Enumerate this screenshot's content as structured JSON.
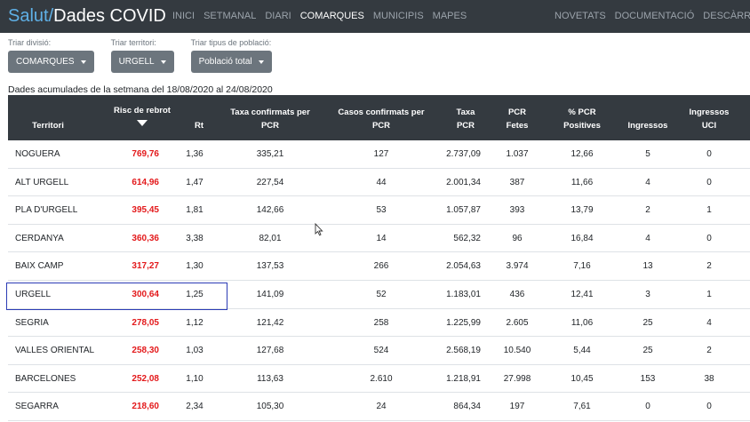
{
  "navbar": {
    "brand_a": "Salut/",
    "brand_b": "Dades COVID",
    "links_left": [
      "INICI",
      "SETMANAL",
      "DIARI",
      "COMARQUES",
      "MUNICIPIS",
      "MAPES"
    ],
    "active_link": "COMARQUES",
    "links_right": [
      "NOVETATS",
      "DOCUMENTACIÓ",
      "DESCÀRREGUES"
    ]
  },
  "filters": [
    {
      "label": "Triar divisió:",
      "value": "COMARQUES"
    },
    {
      "label": "Triar territori:",
      "value": "URGELL"
    },
    {
      "label": "Triar tipus de població:",
      "value": "Població total"
    }
  ],
  "caption": "Dades acumulades de la setmana del 18/08/2020 al 24/08/2020",
  "table": {
    "headers": {
      "territori": "Territori",
      "risc": "Risc de rebrot",
      "rt": "Rt",
      "taxa": "Taxa confirmats per PCR",
      "casos": "Casos confirmats per PCR",
      "taxa_pcr": "Taxa PCR",
      "pcr_fetes": "PCR Fetes",
      "pct_pos": "% PCR Positives",
      "ingressos": "Ingressos",
      "uci": "Ingressos UCI"
    },
    "rows": [
      {
        "name": "NOGUERA",
        "risc": "769,76",
        "rt": "1,36",
        "taxa": "335,21",
        "casos": "127",
        "taxa_pcr": "2.737,09",
        "fetes": "1.037",
        "pos": "12,66",
        "ingr": "5",
        "uci": "0"
      },
      {
        "name": "ALT URGELL",
        "risc": "614,96",
        "rt": "1,47",
        "taxa": "227,54",
        "casos": "44",
        "taxa_pcr": "2.001,34",
        "fetes": "387",
        "pos": "11,66",
        "ingr": "4",
        "uci": "0"
      },
      {
        "name": "PLA D'URGELL",
        "risc": "395,45",
        "rt": "1,81",
        "taxa": "142,66",
        "casos": "53",
        "taxa_pcr": "1.057,87",
        "fetes": "393",
        "pos": "13,79",
        "ingr": "2",
        "uci": "1"
      },
      {
        "name": "CERDANYA",
        "risc": "360,36",
        "rt": "3,38",
        "taxa": "82,01",
        "casos": "14",
        "taxa_pcr": "562,32",
        "fetes": "96",
        "pos": "16,84",
        "ingr": "4",
        "uci": "0"
      },
      {
        "name": "BAIX CAMP",
        "risc": "317,27",
        "rt": "1,30",
        "taxa": "137,53",
        "casos": "266",
        "taxa_pcr": "2.054,63",
        "fetes": "3.974",
        "pos": "7,16",
        "ingr": "13",
        "uci": "2"
      },
      {
        "name": "URGELL",
        "risc": "300,64",
        "rt": "1,25",
        "taxa": "141,09",
        "casos": "52",
        "taxa_pcr": "1.183,01",
        "fetes": "436",
        "pos": "12,41",
        "ingr": "3",
        "uci": "1"
      },
      {
        "name": "SEGRIA",
        "risc": "278,05",
        "rt": "1,12",
        "taxa": "121,42",
        "casos": "258",
        "taxa_pcr": "1.225,99",
        "fetes": "2.605",
        "pos": "11,06",
        "ingr": "25",
        "uci": "4"
      },
      {
        "name": "VALLES ORIENTAL",
        "risc": "258,30",
        "rt": "1,03",
        "taxa": "127,68",
        "casos": "524",
        "taxa_pcr": "2.568,19",
        "fetes": "10.540",
        "pos": "5,44",
        "ingr": "25",
        "uci": "2"
      },
      {
        "name": "BARCELONES",
        "risc": "252,08",
        "rt": "1,10",
        "taxa": "113,63",
        "casos": "2.610",
        "taxa_pcr": "1.218,91",
        "fetes": "27.998",
        "pos": "10,45",
        "ingr": "153",
        "uci": "38"
      },
      {
        "name": "SEGARRA",
        "risc": "218,60",
        "rt": "2,34",
        "taxa": "105,30",
        "casos": "24",
        "taxa_pcr": "864,34",
        "fetes": "197",
        "pos": "7,61",
        "ingr": "0",
        "uci": "0"
      }
    ]
  },
  "icons": {
    "sort": "sort-desc-icon",
    "caret": "caret-down-icon",
    "cursor": "mouse-cursor-icon"
  }
}
